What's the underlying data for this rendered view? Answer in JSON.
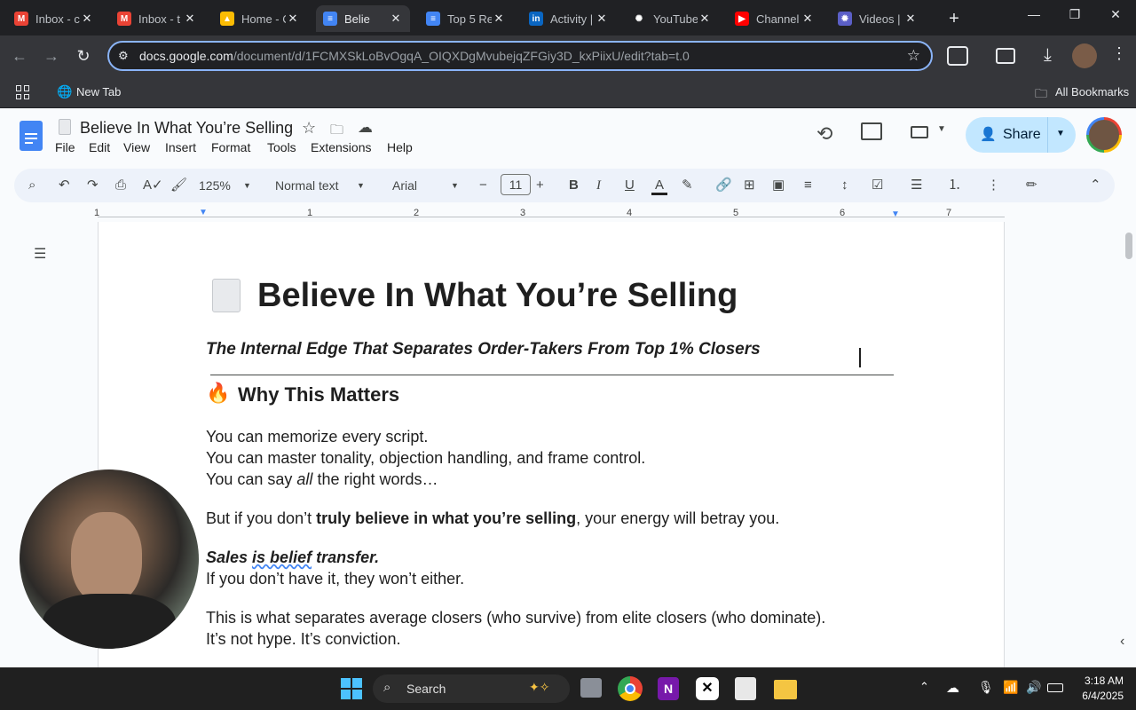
{
  "browser": {
    "tabs": [
      {
        "title": "Inbox - c",
        "favicon": "gmail-icon",
        "color": "#ea4335",
        "glyph": "M"
      },
      {
        "title": "Inbox - t",
        "favicon": "gmail-icon",
        "color": "#ea4335",
        "glyph": "M"
      },
      {
        "title": "Home - C",
        "favicon": "drive-icon",
        "color": "#fbbc04",
        "glyph": "▲"
      },
      {
        "title": "Belie",
        "favicon": "docs-icon",
        "color": "#4285f4",
        "glyph": "≡"
      },
      {
        "title": "Top 5 Re",
        "favicon": "docs-icon",
        "color": "#4285f4",
        "glyph": "≡"
      },
      {
        "title": "Activity |",
        "favicon": "linkedin-icon",
        "color": "#0a66c2",
        "glyph": "in"
      },
      {
        "title": "YouTube",
        "favicon": "openai-icon",
        "color": "#202124",
        "glyph": "✺"
      },
      {
        "title": "Channel",
        "favicon": "youtube-icon",
        "color": "#ff0000",
        "glyph": "▶"
      },
      {
        "title": "Videos |",
        "favicon": "app-icon",
        "color": "#5b5fc7",
        "glyph": "✹"
      }
    ],
    "url_host": "docs.google.com",
    "url_path": "/document/d/1FCMXSkLoBvOgqA_OIQXDgMvubejqZFGiy3D_kxPiixU/edit?tab=t.0",
    "bookmarks": {
      "new_tab": "New Tab",
      "all_bookmarks": "All Bookmarks"
    }
  },
  "docs": {
    "title": "Believe In What You’re Selling",
    "menu": [
      "File",
      "Edit",
      "View",
      "Insert",
      "Format",
      "Tools",
      "Extensions",
      "Help"
    ],
    "share_label": "Share",
    "zoom": "125%",
    "style": "Normal text",
    "font": "Arial",
    "font_size": "11",
    "ruler_marks": [
      "1",
      "1",
      "2",
      "3",
      "4",
      "5",
      "6",
      "7"
    ]
  },
  "document": {
    "heading": "Believe In What You’re Selling",
    "subtitle": "The Internal Edge That Separates Order-Takers From Top 1% Closers",
    "section_title": "Why This Matters",
    "p1_l1": "You can memorize every script.",
    "p1_l2": "You can master tonality, objection handling, and frame control.",
    "p1_l3a": "You can say ",
    "p1_l3b": "all",
    "p1_l3c": " the right words…",
    "p2a": "But if you don’t ",
    "p2b": "truly believe in what you’re selling",
    "p2c": ", your energy will betray you.",
    "p3_l1a": "Sales ",
    "p3_l1b": "is belief",
    "p3_l1c": " transfer.",
    "p3_l2": "If you don’t have it, they won’t either.",
    "p4_l1": "This is what separates average closers (who survive) from elite closers (who dominate).",
    "p4_l2": "It’s not hype. It’s conviction."
  },
  "taskbar": {
    "search_label": "Search",
    "time": "3:18 AM",
    "date": "6/4/2025"
  }
}
